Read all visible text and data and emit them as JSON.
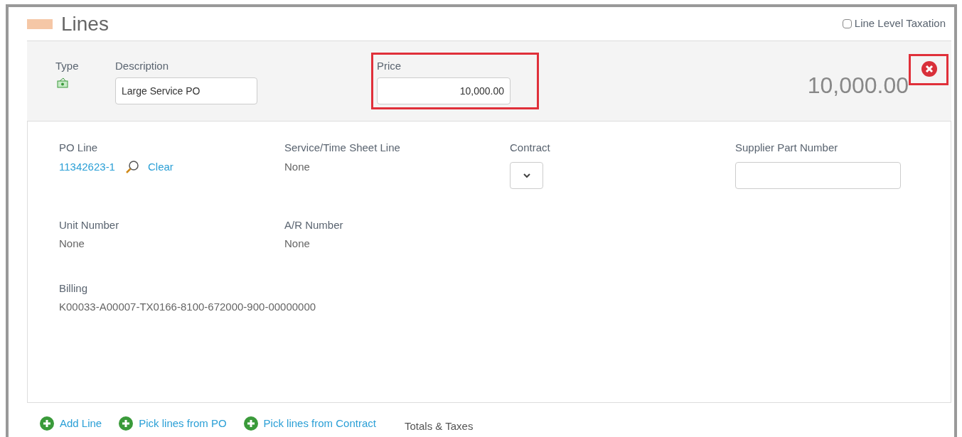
{
  "section": {
    "title": "Lines"
  },
  "line_level_taxation": {
    "label": "Line Level Taxation",
    "checked": false
  },
  "line": {
    "type_label": "Type",
    "description_label": "Description",
    "description": "Large Service PO",
    "price_label": "Price",
    "price": "10,000.00",
    "price_highlighted": true,
    "total": "10,000.00",
    "remove_highlighted": true
  },
  "detail_rows": [
    [
      {
        "kind": "link",
        "label": "PO Line",
        "value": "11342623-1",
        "action": "Clear"
      },
      {
        "kind": "text",
        "label": "Service/Time Sheet Line",
        "value": "None"
      },
      {
        "kind": "select",
        "label": "Contract"
      },
      {
        "kind": "input",
        "label": "Supplier Part Number"
      }
    ],
    [
      {
        "kind": "text",
        "label": "Unit Number",
        "value": "None"
      },
      {
        "kind": "text",
        "label": "A/R Number",
        "value": "None"
      }
    ],
    [
      {
        "kind": "text",
        "label": "Billing",
        "value": "K00033-A00007-TX0166-8100-672000-900-00000000"
      }
    ]
  ],
  "actions": [
    "Add Line",
    "Pick lines from PO",
    "Pick lines from Contract"
  ],
  "totals_tab": "Totals & Taxes"
}
